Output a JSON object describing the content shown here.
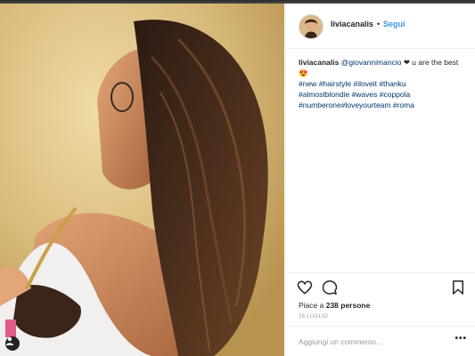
{
  "post": {
    "image_alt_hint": "",
    "tagged_user_icon": "person-icon"
  },
  "header": {
    "username": "liviacanalis",
    "separator": "•",
    "follow_label": "Segui"
  },
  "caption": {
    "username": "liviacanalis",
    "mention": "@giovannimancio",
    "text_after_mention": " ❤ u are the best 😍",
    "hashtags": [
      "#new",
      "#hairstyle",
      "#iloveit",
      "#thanku",
      "#almostblondie",
      "#waves",
      "#coppola",
      "#numberone",
      "#loveyourteam",
      "#roma"
    ]
  },
  "actions": {
    "like_icon": "heart-icon",
    "comment_icon": "comment-icon",
    "save_icon": "bookmark-icon"
  },
  "likes": {
    "prefix": "Piace a ",
    "count": "238 persone"
  },
  "date": "28 LUGLIO",
  "comment_box": {
    "placeholder": "Aggiungi un commento...",
    "more_label": "•••"
  },
  "colors": {
    "link_blue": "#3897f0",
    "text": "#262626",
    "muted": "#999999",
    "border": "#efefef"
  }
}
